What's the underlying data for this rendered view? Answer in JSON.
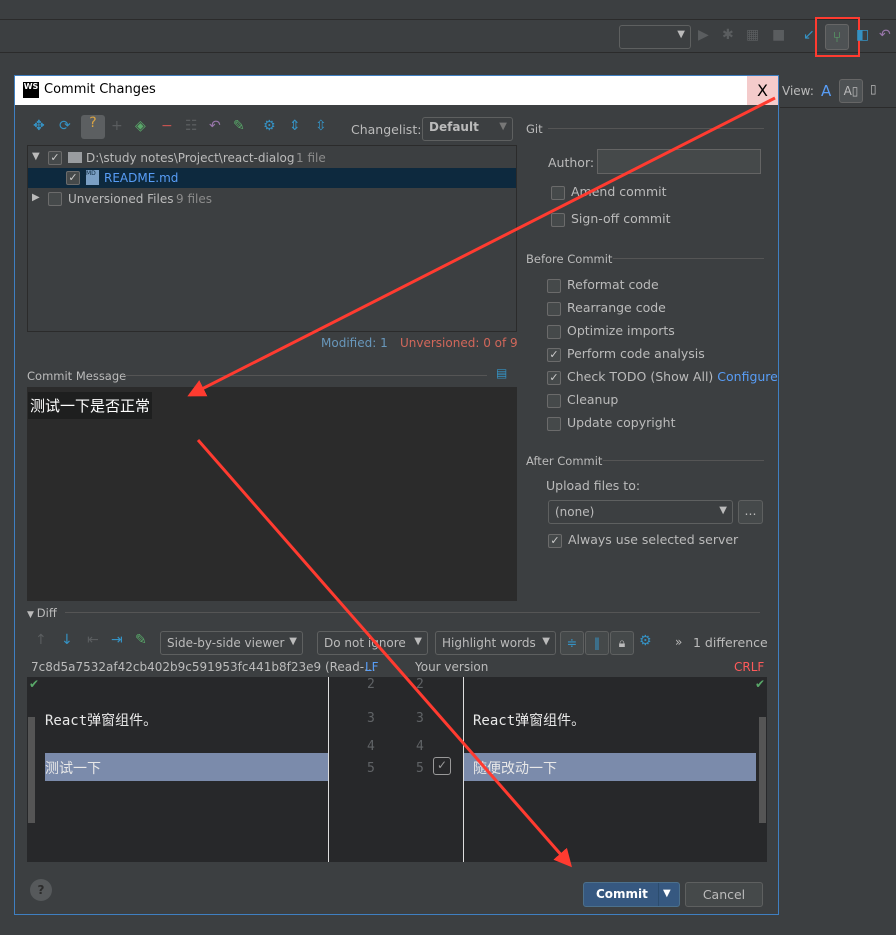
{
  "ide": {
    "view_label": "View:"
  },
  "dialog": {
    "title": "Commit Changes",
    "close": "X",
    "changelist_label": "Changelist:",
    "changelist_value": "Default",
    "tree": [
      {
        "label": "D:\\study notes\\Project\\react-dialog",
        "count": "1 file",
        "checked": true,
        "expanded": true
      },
      {
        "label": "README.md",
        "checked": true,
        "selected": true
      },
      {
        "label": "Unversioned Files",
        "count": "9 files",
        "checked": false,
        "expanded": false
      }
    ],
    "status": {
      "modified": "Modified: 1",
      "unversioned": "Unversioned: 0 of 9"
    },
    "commit_message_label": "Commit Message",
    "commit_message": "测试一下是否正常",
    "git": {
      "header": "Git",
      "author_label": "Author:",
      "author_value": "",
      "amend": "Amend commit",
      "signoff": "Sign-off commit"
    },
    "before_commit": {
      "header": "Before Commit",
      "options": [
        {
          "label": "Reformat code",
          "checked": false
        },
        {
          "label": "Rearrange code",
          "checked": false
        },
        {
          "label": "Optimize imports",
          "checked": false
        },
        {
          "label": "Perform code analysis",
          "checked": true
        },
        {
          "label": "Check TODO (Show All)",
          "checked": true,
          "link": "Configure"
        },
        {
          "label": "Cleanup",
          "checked": false
        },
        {
          "label": "Update copyright",
          "checked": false
        }
      ]
    },
    "after_commit": {
      "header": "After Commit",
      "upload_label": "Upload files to:",
      "upload_value": "(none)",
      "browse": "...",
      "always_use": "Always use selected server",
      "always_use_checked": true
    },
    "diff": {
      "header": "Diff",
      "viewer": "Side-by-side viewer",
      "ignore": "Do not ignore",
      "highlight": "Highlight words",
      "differences": "1 difference",
      "left_title": "7c8d5a7532af42cb402b9c591953fc441b8f23e9 (Read-...",
      "left_sep": "LF",
      "right_title": "Your version",
      "right_sep": "CRLF",
      "lines": [
        {
          "l": "2",
          "r": "2",
          "left": "",
          "right": ""
        },
        {
          "l": "3",
          "r": "3",
          "left": "React弹窗组件。",
          "right": "React弹窗组件。"
        },
        {
          "l": "4",
          "r": "4",
          "left": "",
          "right": ""
        },
        {
          "l": "5",
          "r": "5",
          "left": "测试一下",
          "right": "随便改动一下",
          "changed": true
        }
      ]
    },
    "help": "?",
    "commit_button": "Commit",
    "cancel_button": "Cancel"
  },
  "colors": {
    "accent": "#3f7fc1",
    "annotation": "#ff3b30",
    "changed_line": "#7b8bab",
    "link": "#589df6",
    "unversioned": "#d1675a"
  }
}
